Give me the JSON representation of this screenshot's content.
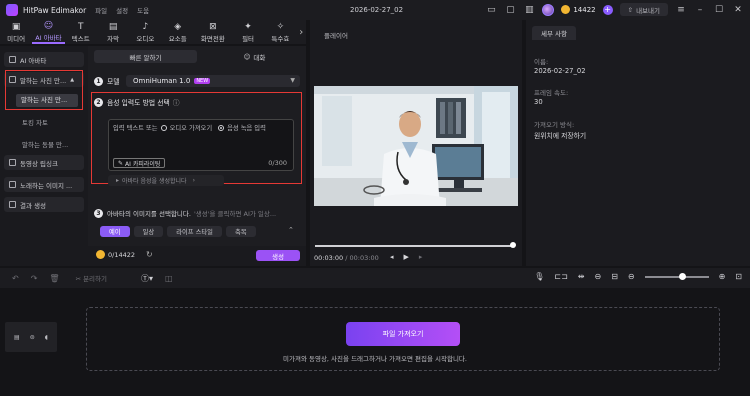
{
  "app": {
    "name": "HitPaw Edimakor",
    "document_title": "2026-02-27_02"
  },
  "menu": [
    "파일",
    "설정",
    "도움"
  ],
  "titlebar": {
    "credits": "14422",
    "export_label": "내보내기"
  },
  "toolbar": [
    {
      "icon": "media-icon",
      "glyph": "▣",
      "label": "미디어"
    },
    {
      "icon": "ai-avatar-icon",
      "glyph": "☺",
      "label": "AI 아바타",
      "active": true
    },
    {
      "icon": "text-icon",
      "glyph": "T",
      "label": "텍스트"
    },
    {
      "icon": "subtitle-icon",
      "glyph": "▤",
      "label": "자막"
    },
    {
      "icon": "audio-icon",
      "glyph": "♪",
      "label": "오디오"
    },
    {
      "icon": "elements-icon",
      "glyph": "◈",
      "label": "요소들"
    },
    {
      "icon": "transition-icon",
      "glyph": "⊠",
      "label": "화면전환"
    },
    {
      "icon": "filter-icon",
      "glyph": "✦",
      "label": "필터"
    },
    {
      "icon": "effects-icon",
      "glyph": "✧",
      "label": "특수효"
    }
  ],
  "sidebar": {
    "items": [
      {
        "label": "AI 아바타"
      },
      {
        "label": "말하는 사진 만..."
      },
      {
        "label": "동영상 립싱크"
      },
      {
        "label": "노래하는 이미지 ..."
      },
      {
        "label": "결과 생성"
      }
    ],
    "subitems": [
      {
        "label": "말하는 사진 만..."
      },
      {
        "label": "토킹 자토"
      },
      {
        "label": "말하는 동물 만..."
      }
    ]
  },
  "panel": {
    "tab_quick": "빠른 알하기",
    "tab_custom": "대화",
    "model_label": "모델",
    "model_value": "OmniHuman 1.0",
    "new_badge": "NEW",
    "step2_title": "음성 입력도 방법 선택",
    "mode_text": "입력 텍스트 또는",
    "mode_upload": "오디오 가져오기",
    "mode_record": "음성 녹음 입력",
    "ai_button": "AI 카피라이팅",
    "counter": "0/300",
    "preview_label": "아바타 음성을 생성합니다",
    "step3_title": "아바타의 이미지를 선택합니다.",
    "step3_hint": "'생성'을 클릭하면 AI가 일상...",
    "categories": [
      "예이",
      "일상",
      "라이프 스타일",
      "축복"
    ],
    "gen_credits": "0/14422",
    "generate": "생성"
  },
  "player": {
    "title": "플레이어",
    "time_current": "00:03:00",
    "time_total": "00:03:00"
  },
  "details": {
    "tab": "세부 사항",
    "name_label": "이름:",
    "name_value": "2026-02-27_02",
    "fps_label": "프레임 속도:",
    "fps_value": "30",
    "location_label": "가져오기 방식:",
    "location_value": "원위치에 저장하기"
  },
  "timeline": {
    "split_label": "분리하기",
    "import_button": "파일 가져오기",
    "import_hint": "미가져와 동영상, 사진을 드래그하거나 가져오면 편집을 시작합니다."
  }
}
